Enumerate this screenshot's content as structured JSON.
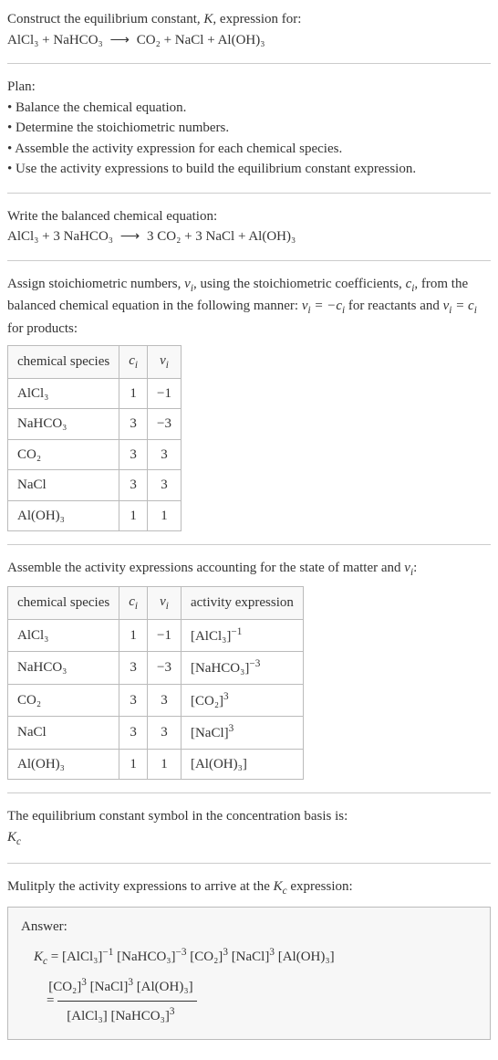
{
  "intro": {
    "line1": "Construct the equilibrium constant, K, expression for:",
    "equation_lhs": "AlCl₃ + NaHCO₃",
    "equation_rhs": "CO₂ + NaCl + Al(OH)₃"
  },
  "plan": {
    "heading": "Plan:",
    "items": [
      "Balance the chemical equation.",
      "Determine the stoichiometric numbers.",
      "Assemble the activity expression for each chemical species.",
      "Use the activity expressions to build the equilibrium constant expression."
    ]
  },
  "balanced": {
    "heading": "Write the balanced chemical equation:",
    "lhs": "AlCl₃ + 3 NaHCO₃",
    "rhs": "3 CO₂ + 3 NaCl + Al(OH)₃"
  },
  "stoich": {
    "text_a": "Assign stoichiometric numbers, ",
    "text_b": ", using the stoichiometric coefficients, ",
    "text_c": ", from the balanced chemical equation in the following manner: ",
    "text_d": " for reactants and ",
    "text_e": " for products:",
    "headers": [
      "chemical species",
      "cᵢ",
      "νᵢ"
    ],
    "rows": [
      [
        "AlCl₃",
        "1",
        "−1"
      ],
      [
        "NaHCO₃",
        "3",
        "−3"
      ],
      [
        "CO₂",
        "3",
        "3"
      ],
      [
        "NaCl",
        "3",
        "3"
      ],
      [
        "Al(OH)₃",
        "1",
        "1"
      ]
    ]
  },
  "activity": {
    "heading": "Assemble the activity expressions accounting for the state of matter and νᵢ:",
    "headers": [
      "chemical species",
      "cᵢ",
      "νᵢ",
      "activity expression"
    ],
    "rows": [
      {
        "species": "AlCl₃",
        "c": "1",
        "v": "−1",
        "expr_base": "[AlCl₃]",
        "expr_sup": "−1"
      },
      {
        "species": "NaHCO₃",
        "c": "3",
        "v": "−3",
        "expr_base": "[NaHCO₃]",
        "expr_sup": "−3"
      },
      {
        "species": "CO₂",
        "c": "3",
        "v": "3",
        "expr_base": "[CO₂]",
        "expr_sup": "3"
      },
      {
        "species": "NaCl",
        "c": "3",
        "v": "3",
        "expr_base": "[NaCl]",
        "expr_sup": "3"
      },
      {
        "species": "Al(OH)₃",
        "c": "1",
        "v": "1",
        "expr_base": "[Al(OH)₃]",
        "expr_sup": ""
      }
    ]
  },
  "basis": {
    "line1": "The equilibrium constant symbol in the concentration basis is:",
    "symbol": "K꜀"
  },
  "multiply": {
    "heading": "Mulitply the activity expressions to arrive at the K꜀ expression:"
  },
  "answer": {
    "label": "Answer:",
    "kc": "K꜀",
    "eq": " = ",
    "line1_terms": [
      {
        "base": "[AlCl₃]",
        "sup": "−1"
      },
      {
        "base": "[NaHCO₃]",
        "sup": "−3"
      },
      {
        "base": "[CO₂]",
        "sup": "3"
      },
      {
        "base": "[NaCl]",
        "sup": "3"
      },
      {
        "base": "[Al(OH)₃]",
        "sup": ""
      }
    ],
    "frac_num": [
      {
        "base": "[CO₂]",
        "sup": "3"
      },
      {
        "base": "[NaCl]",
        "sup": "3"
      },
      {
        "base": "[Al(OH)₃]",
        "sup": ""
      }
    ],
    "frac_den": [
      {
        "base": "[AlCl₃]",
        "sup": ""
      },
      {
        "base": "[NaHCO₃]",
        "sup": "3"
      }
    ]
  },
  "arrow": "⟶"
}
